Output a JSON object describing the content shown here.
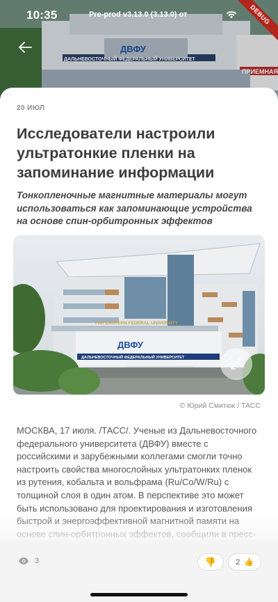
{
  "status_bar": {
    "time": "10:35",
    "build": "Pre-prod v3.13.0 (3.13.0) от",
    "debug": "DEBUG"
  },
  "article": {
    "date": "20 ИЮЛ",
    "title": "Исследователи настроили ультратонкие пленки на запоминание информации",
    "lead": "Тонкопленочные магнитные материалы могут использоваться как запоминающие устройства на основе спин-орбитронных эффектов",
    "credit": "© Юрий Смитюк / ТАСС",
    "body": "МОСКВА, 17 июля. /ТАСС/. Ученые из Дальневосточного федерального университета (ДВФУ) вместе с российскими и зарубежными коллегами смогли точно настроить свойства многослойных ультратонких пленок из рутения, кобальта и вольфрама (Ru/Co/W/Ru) с толщиной слоя в один атом. В перспективе это может быть использовано для проектирования и изготовления быстрой и энергоэффективной магнитной памяти на основе спин-орбитронных эффектов, сообщили в пресс-службе Минобрнауки РФ в понедельник."
  },
  "photo_signage": {
    "logo": "ДВФУ",
    "sign_ru": "ДАЛЬНЕВОСТОЧНЫЙ ФЕДЕРАЛЬНЫЙ УНИВЕРСИТЕТ",
    "sign_en": "FAR EASTERN FEDERAL UNIVERSITY",
    "priemnaya": "ПРИЕМНАЯ"
  },
  "bottom_bar": {
    "views": "3",
    "likes": "2"
  },
  "colors": {
    "accent_red": "#b3261e",
    "text_dark": "#3c3c3c",
    "bar_bg": "#f4f4f4"
  },
  "icons": [
    "back-arrow-icon",
    "wifi-icon",
    "battery-icon",
    "expand-icon",
    "eye-icon",
    "thumbs-down-icon",
    "thumbs-up-icon"
  ]
}
